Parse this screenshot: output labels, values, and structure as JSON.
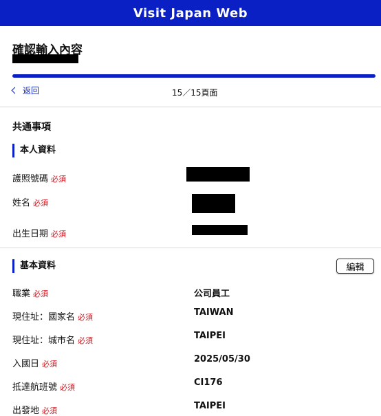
{
  "header": {
    "title": "Visit Japan Web"
  },
  "page": {
    "title": "確認輸入內容",
    "back_label": "返回",
    "page_count": "15／15頁面"
  },
  "common": {
    "title": "共通事項",
    "personal": {
      "title": "本人資料",
      "required_label": "必須",
      "fields": [
        {
          "label": "護照號碼"
        },
        {
          "label": "姓名"
        },
        {
          "label": "出生日期"
        }
      ]
    },
    "basic": {
      "title": "基本資料",
      "edit_label": "編輯",
      "required_label": "必須",
      "fields": [
        {
          "label": "職業",
          "value": "公司員工"
        },
        {
          "label": "現住址：國家名",
          "value": "TAIWAN"
        },
        {
          "label": "現住址：城市名",
          "value": "TAIPEI"
        },
        {
          "label": "入國日",
          "value": "2025/05/30"
        },
        {
          "label": "抵達航班號",
          "value": "CI176"
        },
        {
          "label": "出發地",
          "value": "TAIPEI"
        }
      ]
    }
  }
}
